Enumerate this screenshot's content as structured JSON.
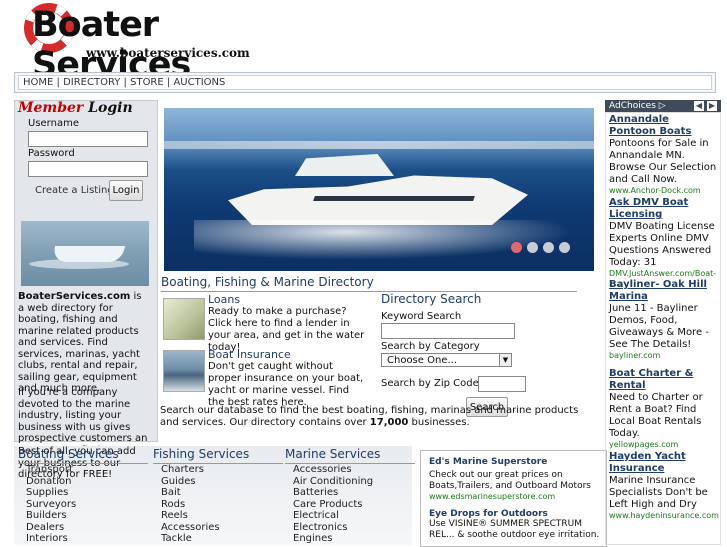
{
  "header": {
    "logo_title": "Boater Services",
    "logo_url": "www.boaterservices.com"
  },
  "nav": {
    "items": [
      "HOME",
      "DIRECTORY",
      "STORE",
      "AUCTIONS"
    ],
    "separator": " | "
  },
  "login": {
    "title_a": "Member",
    "title_b": "Login",
    "username_label": "Username",
    "password_label": "Password",
    "create_link": "Create a Listing",
    "login_button": "Login"
  },
  "about": {
    "brand": "BoaterServices.com",
    "p1_rest": " is a web directory for boating, fishing and marine related products and services. Find services, marinas, yacht clubs, rental and repair, sailing gear, equipment and much more.",
    "p2": "If you're a company devoted to the marine industry, listing your business with us gives prospective customers an easy way to find you.",
    "p3": "Best of all, you can add your business to our directory for FREE!"
  },
  "hero": {
    "slides": 4,
    "active_slide": 1
  },
  "directory": {
    "title": "Boating, Fishing & Marine Directory",
    "loans": {
      "title": "Loans",
      "desc": "Ready to make a purchase? Click here to find a lender in your area, and get in the water today!"
    },
    "insurance": {
      "title": "Boat Insurance",
      "desc": "Don't get caught without proper insurance on your boat, yacht or marine vessel. Find the best rates here."
    },
    "intro_a": "Search our database to find the best boating, fishing, marinas and marine products and services. Our directory contains over ",
    "intro_count": "17,000",
    "intro_b": " businesses."
  },
  "search": {
    "title": "Directory Search",
    "keyword_label": "Keyword Search",
    "category_label": "Search by Category",
    "category_value": "Choose One...",
    "zip_label": "Search by Zip Code",
    "button": "Search"
  },
  "categories": {
    "boating": {
      "title": "Boating Services",
      "items": [
        "Transport",
        "Donation",
        "Supplies",
        "Surveyors",
        "Builders",
        "Dealers",
        "Interiors"
      ]
    },
    "fishing": {
      "title": "Fishing Services",
      "items": [
        "Charters",
        "Guides",
        "Bait",
        "Rods",
        "Reels",
        "Accessories",
        "Tackle"
      ]
    },
    "marine": {
      "title": "Marine Services",
      "items": [
        "Accessories",
        "Air Conditioning",
        "Batteries",
        "Care Products",
        "Electrical",
        "Electronics",
        "Engines"
      ]
    }
  },
  "mid_ads": [
    {
      "title": "Ed's Marine Superstore",
      "desc": "Check out our great prices on Boats,Trailers, and Outboard Motors",
      "url": "www.edsmarinesuperstore.com"
    },
    {
      "title": "Eye Drops for Outdoors",
      "desc": "Use VISINE® SUMMER SPECTRUM REL... & soothe outdoor eye irritation."
    }
  ],
  "right_ads": {
    "adchoices": "AdChoices",
    "items": [
      {
        "title": "Annandale Pontoon Boats",
        "desc": "Pontoons for Sale in Annandale MN. Browse Our Selection and Call Now.",
        "url": "www.Anchor-Dock.com"
      },
      {
        "title": "Ask DMV Boat Licensing",
        "desc": "DMV Boating License Experts Online DMV Questions Answered Today: 31",
        "url": "DMV.JustAnswer.com/Boat-L..."
      },
      {
        "title": "Bayliner- Oak Hill Marina",
        "desc": "June 11 - Bayliner Demos, Food, Giveaways & More - See The Details!",
        "url": "bayliner.com"
      },
      {
        "title": "Boat Charter & Rental",
        "desc": "Need to Charter or Rent a Boat? Find Local Boat Rentals Today.",
        "url": "yellowpages.com"
      },
      {
        "title": "Hayden Yacht Insurance",
        "desc": "Marine Insurance Specialists Don't be Left High and Dry",
        "url": "www.haydeninsurance.com"
      }
    ]
  },
  "colors": {
    "accent_red": "#c40000",
    "heading_blue": "#1e3e68",
    "ad_url_green": "#1a7a1a"
  }
}
